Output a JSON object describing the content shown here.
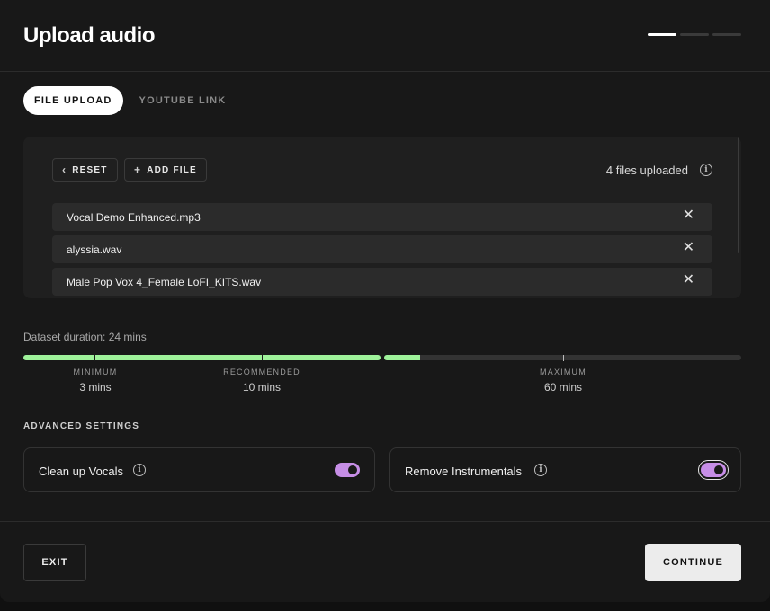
{
  "header": {
    "title": "Upload audio",
    "steps": [
      {
        "active": true
      },
      {
        "active": false
      },
      {
        "active": false
      }
    ]
  },
  "tabs": [
    {
      "label": "FILE UPLOAD",
      "active": true
    },
    {
      "label": "YOUTUBE LINK",
      "active": false
    }
  ],
  "files_panel": {
    "reset_label": "RESET",
    "add_file_label": "ADD FILE",
    "count_text": "4 files uploaded",
    "files": [
      {
        "name": "Vocal Demo Enhanced.mp3"
      },
      {
        "name": "alyssia.wav"
      },
      {
        "name": "Male Pop Vox 4_Female LoFI_KITS.wav"
      }
    ]
  },
  "duration": {
    "label": "Dataset duration: 24 mins",
    "value_mins": 24,
    "max_mins": 60,
    "markers": [
      {
        "label": "MINIMUM",
        "value": "3 mins"
      },
      {
        "label": "RECOMMENDED",
        "value": "10 mins"
      },
      {
        "label": "MAXIMUM",
        "value": "60 mins"
      }
    ]
  },
  "advanced": {
    "label": "ADVANCED SETTINGS",
    "settings": [
      {
        "label": "Clean up Vocals",
        "enabled": true
      },
      {
        "label": "Remove Instrumentals",
        "enabled": true
      }
    ]
  },
  "footer": {
    "exit_label": "EXIT",
    "continue_label": "CONTINUE"
  },
  "colors": {
    "accent_green": "#9ef29a",
    "toggle_purple": "#c68ee6",
    "background": "#181818"
  }
}
